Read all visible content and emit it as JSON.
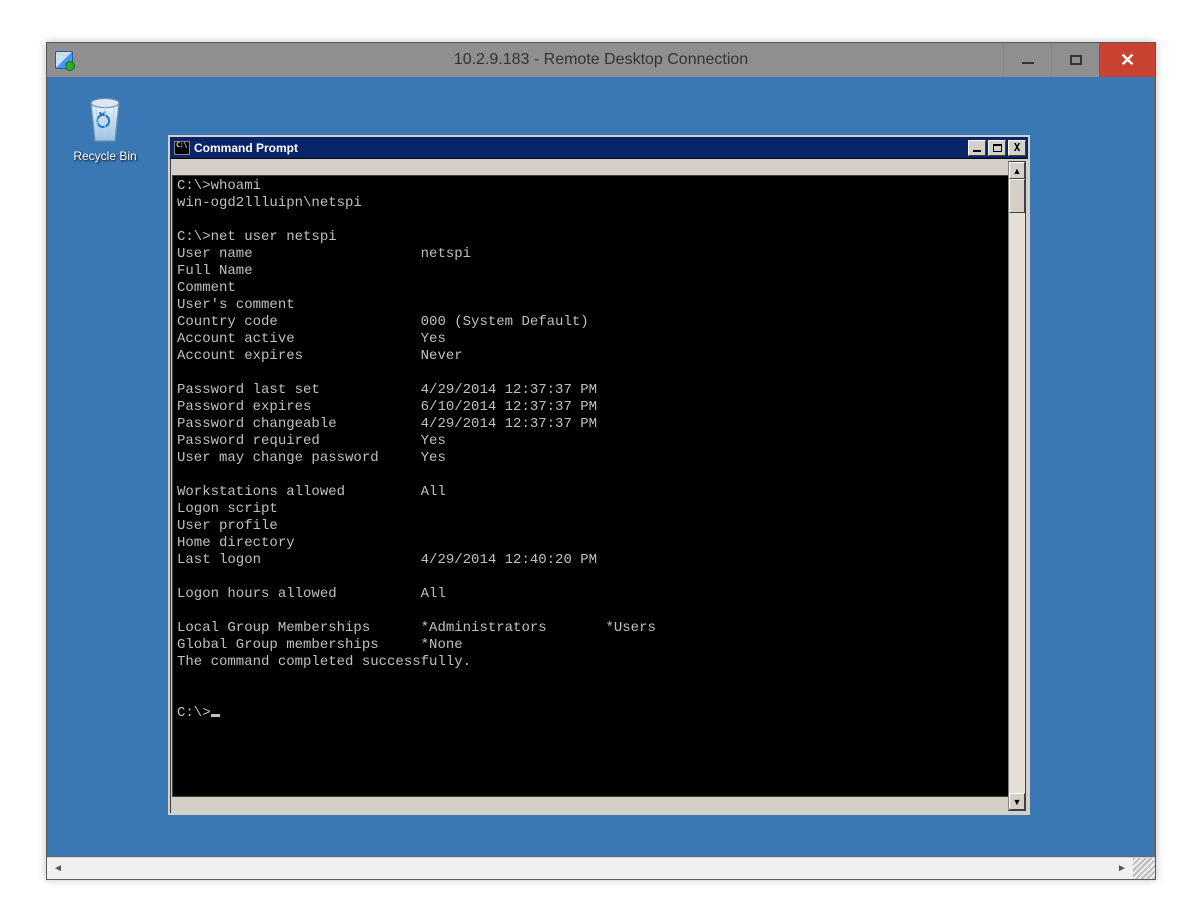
{
  "rdc": {
    "title": "10.2.9.183 - Remote Desktop Connection"
  },
  "desktop": {
    "recycle_bin_label": "Recycle Bin"
  },
  "cmd": {
    "title": "Command Prompt",
    "lines": [
      "C:\\>whoami",
      "win-ogd2llluipn\\netspi",
      "",
      "C:\\>net user netspi",
      "User name                    netspi",
      "Full Name",
      "Comment",
      "User's comment",
      "Country code                 000 (System Default)",
      "Account active               Yes",
      "Account expires              Never",
      "",
      "Password last set            4/29/2014 12:37:37 PM",
      "Password expires             6/10/2014 12:37:37 PM",
      "Password changeable          4/29/2014 12:37:37 PM",
      "Password required            Yes",
      "User may change password     Yes",
      "",
      "Workstations allowed         All",
      "Logon script",
      "User profile",
      "Home directory",
      "Last logon                   4/29/2014 12:40:20 PM",
      "",
      "Logon hours allowed          All",
      "",
      "Local Group Memberships      *Administrators       *Users",
      "Global Group memberships     *None",
      "The command completed successfully.",
      "",
      "",
      "C:\\>"
    ]
  }
}
